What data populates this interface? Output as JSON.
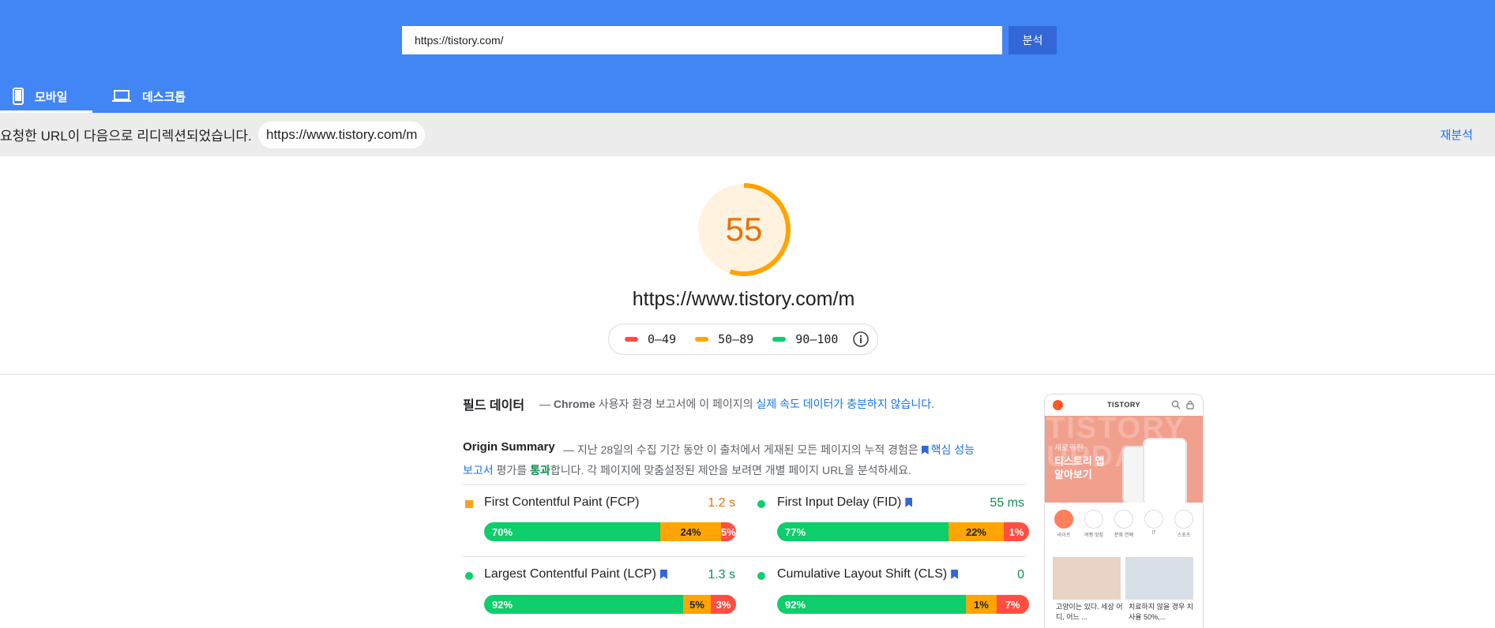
{
  "search": {
    "url_value": "https://tistory.com/",
    "analyze_label": "분석"
  },
  "tabs": [
    {
      "label": "모바일",
      "icon": "smartphone-icon"
    },
    {
      "label": "데스크톱",
      "icon": "laptop-icon"
    }
  ],
  "redirect": {
    "message": "요청한 URL이 다음으로 리디렉션되었습니다.",
    "url": "https://www.tistory.com/m",
    "reanalyze_label": "재분석"
  },
  "score": {
    "value": "55",
    "progress": 0.55,
    "color": "#ffa400",
    "url": "https://www.tistory.com/m"
  },
  "legend": [
    {
      "range": "0–49",
      "color": "#ff4e42"
    },
    {
      "range": "50–89",
      "color": "#ffa400"
    },
    {
      "range": "90–100",
      "color": "#0cce6b"
    }
  ],
  "field_data": {
    "title": "필드 데이터",
    "desc_prefix": "— ",
    "desc_chrome": "Chrome",
    "desc_mid": " 사용자 환경 보고서에 이 페이지의 ",
    "desc_link": "실제 속도 데이터가 충분하지 않습니다",
    "desc_end": "."
  },
  "origin": {
    "title": "Origin Summary",
    "desc_part1": "— 지난 28일의 수집 기간 동안 이 출처에서 게재된 모든 페이지의 누적 경험은 ",
    "desc_link": "핵심 성능 보고서",
    "desc_part2": " 평가를 ",
    "desc_pass": "통과",
    "desc_part3": "합니다. 각 페이지에 맞춤설정된 제안을 보려면 개별 페이지 URL을 분석하세요."
  },
  "metrics": [
    {
      "name": "First Contentful Paint (FCP)",
      "value": "1.2 s",
      "status": "average",
      "core": false,
      "good": "70%",
      "avg": "24%",
      "poor": "5%",
      "good_frac": 0.7,
      "avg_frac": 0.24,
      "poor_frac": 0.06
    },
    {
      "name": "First Input Delay (FID)",
      "value": "55 ms",
      "status": "good",
      "core": true,
      "good": "77%",
      "avg": "22%",
      "poor": "1%",
      "good_frac": 0.68,
      "avg_frac": 0.22,
      "poor_frac": 0.1
    },
    {
      "name": "Largest Contentful Paint (LCP)",
      "value": "1.3 s",
      "status": "good",
      "core": true,
      "good": "92%",
      "avg": "5%",
      "poor": "3%",
      "good_frac": 0.79,
      "avg_frac": 0.11,
      "poor_frac": 0.1
    },
    {
      "name": "Cumulative Layout Shift (CLS)",
      "value": "0",
      "status": "good",
      "core": true,
      "good": "92%",
      "avg": "1%",
      "poor": "7%",
      "good_frac": 0.75,
      "avg_frac": 0.12,
      "poor_frac": 0.13
    }
  ],
  "screenshot": {
    "brand": "TISTORY",
    "banner_small": "새로워진",
    "banner_line1": "티스토리 앱",
    "banner_line2": "알아보기",
    "banner_bg": "TISTORY UPDATE",
    "categories": [
      "라이프",
      "여행·맛집",
      "문화·연예",
      "IT",
      "스포츠"
    ],
    "captions": [
      "고양이는 있다. 세상 어디, 어느 ...",
      "치료하지 않을 경우 치사율 50%,..."
    ]
  }
}
